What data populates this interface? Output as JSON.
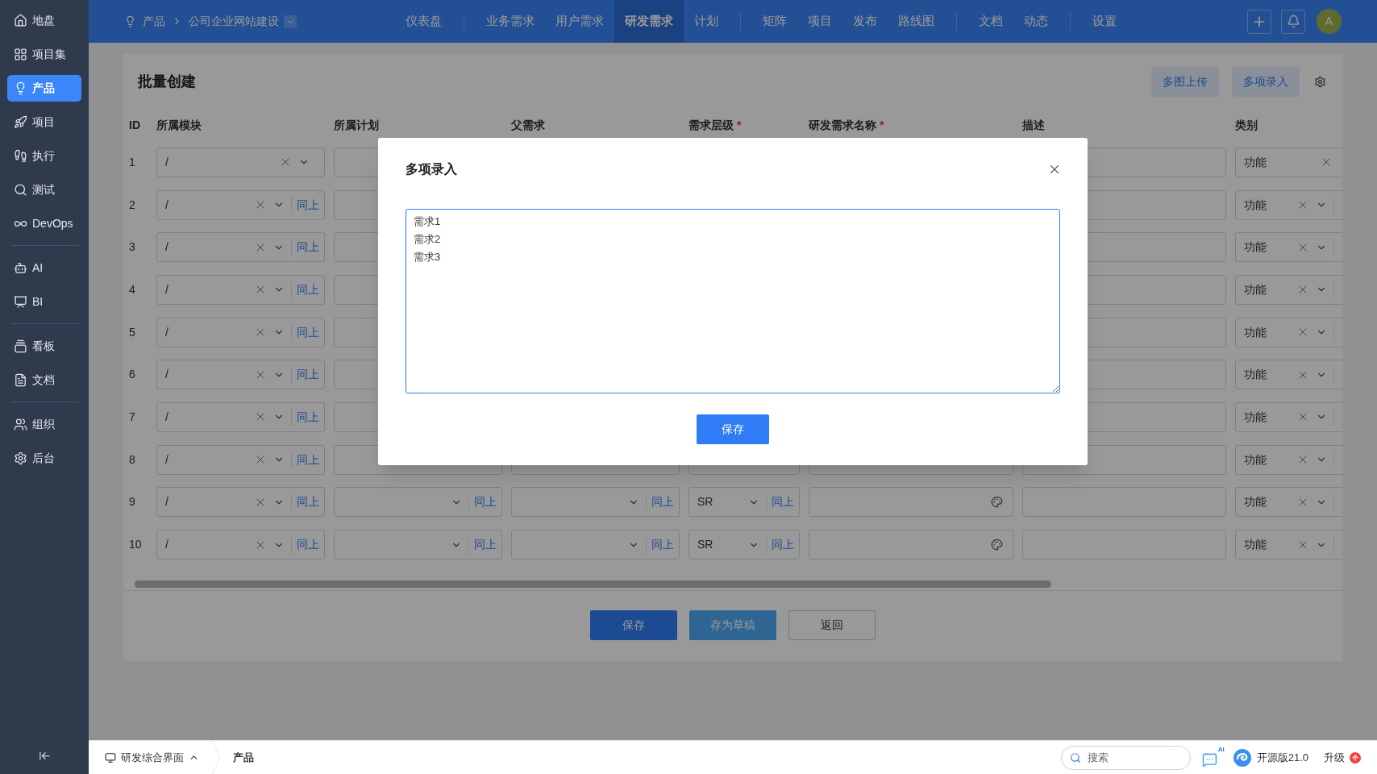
{
  "sidebar": {
    "groups": [
      {
        "items": [
          {
            "label": "地盘",
            "selected": false
          },
          {
            "label": "项目集",
            "selected": false
          },
          {
            "label": "产品",
            "selected": true
          },
          {
            "label": "项目",
            "selected": false
          },
          {
            "label": "执行",
            "selected": false
          },
          {
            "label": "测试",
            "selected": false
          },
          {
            "label": "DevOps",
            "selected": false
          }
        ]
      },
      {
        "items": [
          {
            "label": "AI",
            "selected": false
          },
          {
            "label": "BI",
            "selected": false
          }
        ]
      },
      {
        "items": [
          {
            "label": "看板",
            "selected": false
          },
          {
            "label": "文档",
            "selected": false
          }
        ]
      },
      {
        "items": [
          {
            "label": "组织",
            "selected": false
          },
          {
            "label": "后台",
            "selected": false
          }
        ]
      }
    ]
  },
  "topbar": {
    "breadcrumb": {
      "section": "产品",
      "project": "公司企业网站建设"
    },
    "nav": [
      {
        "items": [
          {
            "label": "仪表盘",
            "selected": false
          }
        ]
      },
      {
        "items": [
          {
            "label": "业务需求",
            "selected": false
          },
          {
            "label": "用户需求",
            "selected": false
          },
          {
            "label": "研发需求",
            "selected": true
          },
          {
            "label": "计划",
            "selected": false
          }
        ]
      },
      {
        "items": [
          {
            "label": "矩阵",
            "selected": false
          },
          {
            "label": "项目",
            "selected": false
          },
          {
            "label": "发布",
            "selected": false
          },
          {
            "label": "路线图",
            "selected": false
          }
        ]
      },
      {
        "items": [
          {
            "label": "文档",
            "selected": false
          },
          {
            "label": "动态",
            "selected": false
          }
        ]
      },
      {
        "items": [
          {
            "label": "设置",
            "selected": false
          }
        ]
      }
    ],
    "avatar": "A"
  },
  "page": {
    "title": "批量创建",
    "actions": [
      "多图上传",
      "多项录入"
    ],
    "table": {
      "required_mark": "*",
      "columns": [
        {
          "label": "ID",
          "required": false
        },
        {
          "label": "所属模块",
          "required": false
        },
        {
          "label": "所属计划",
          "required": false
        },
        {
          "label": "父需求",
          "required": false
        },
        {
          "label": "需求层级",
          "required": true
        },
        {
          "label": "研发需求名称",
          "required": true
        },
        {
          "label": "描述",
          "required": false
        },
        {
          "label": "类别",
          "required": false
        }
      ],
      "rows": [
        {
          "id": "1",
          "module": {
            "value": "/",
            "clearable": true
          },
          "plan": {},
          "desc": {},
          "category": {
            "value": "功能",
            "clearable": true,
            "linked": false
          }
        },
        {
          "id": "2",
          "module": {
            "value": "/",
            "clearable": true,
            "same": "同上"
          },
          "plan": {},
          "desc": {},
          "category": {
            "value": "功能",
            "clearable": true,
            "linked": true
          }
        },
        {
          "id": "3",
          "module": {
            "value": "/",
            "clearable": true,
            "same": "同上"
          },
          "plan": {},
          "desc": {},
          "category": {
            "value": "功能",
            "clearable": true,
            "linked": true
          }
        },
        {
          "id": "4",
          "module": {
            "value": "/",
            "clearable": true,
            "same": "同上"
          },
          "plan": {},
          "desc": {},
          "category": {
            "value": "功能",
            "clearable": true,
            "linked": true
          }
        },
        {
          "id": "5",
          "module": {
            "value": "/",
            "clearable": true,
            "same": "同上"
          },
          "plan": {},
          "desc": {},
          "category": {
            "value": "功能",
            "clearable": true,
            "linked": true
          }
        },
        {
          "id": "6",
          "module": {
            "value": "/",
            "clearable": true,
            "same": "同上"
          },
          "plan": {},
          "desc": {},
          "category": {
            "value": "功能",
            "clearable": true,
            "linked": true
          }
        },
        {
          "id": "7",
          "module": {
            "value": "/",
            "clearable": true,
            "same": "同上"
          },
          "plan": {},
          "desc": {},
          "category": {
            "value": "功能",
            "clearable": true,
            "linked": true
          }
        },
        {
          "id": "8",
          "module": {
            "value": "/",
            "clearable": true,
            "same": "同上"
          },
          "plan": {},
          "parent": {},
          "level": {},
          "name": {
            "color_picker": false
          },
          "desc": {},
          "category": {
            "value": "功能",
            "clearable": true,
            "linked": true
          }
        },
        {
          "id": "9",
          "module": {
            "value": "/",
            "clearable": true,
            "same": "同上"
          },
          "plan": {
            "same": "同上"
          },
          "parent": {
            "same": "同上"
          },
          "level": {
            "value": "SR",
            "same": "同上"
          },
          "name": {
            "color_picker": true
          },
          "desc": {},
          "category": {
            "value": "功能",
            "clearable": true,
            "linked": true
          }
        },
        {
          "id": "10",
          "module": {
            "value": "/",
            "clearable": true,
            "same": "同上"
          },
          "plan": {
            "same": "同上"
          },
          "parent": {
            "same": "同上"
          },
          "level": {
            "value": "SR",
            "same": "同上"
          },
          "name": {
            "color_picker": true
          },
          "desc": {},
          "category": {
            "value": "功能",
            "clearable": true,
            "linked": true
          }
        }
      ]
    },
    "buttons": [
      {
        "label": "保存",
        "kind": "primary"
      },
      {
        "label": "存为草稿",
        "kind": "secondary"
      },
      {
        "label": "返回",
        "kind": "outline"
      }
    ]
  },
  "modal": {
    "title": "多项录入",
    "text": "需求1\n需求2\n需求3",
    "button": "保存"
  },
  "bottombar": {
    "workspace": "研发综合界面",
    "crumb": "产品",
    "search_placeholder": "搜索",
    "ai_badge": "AI",
    "version": "开源版21.0",
    "upgrade": "升级"
  }
}
